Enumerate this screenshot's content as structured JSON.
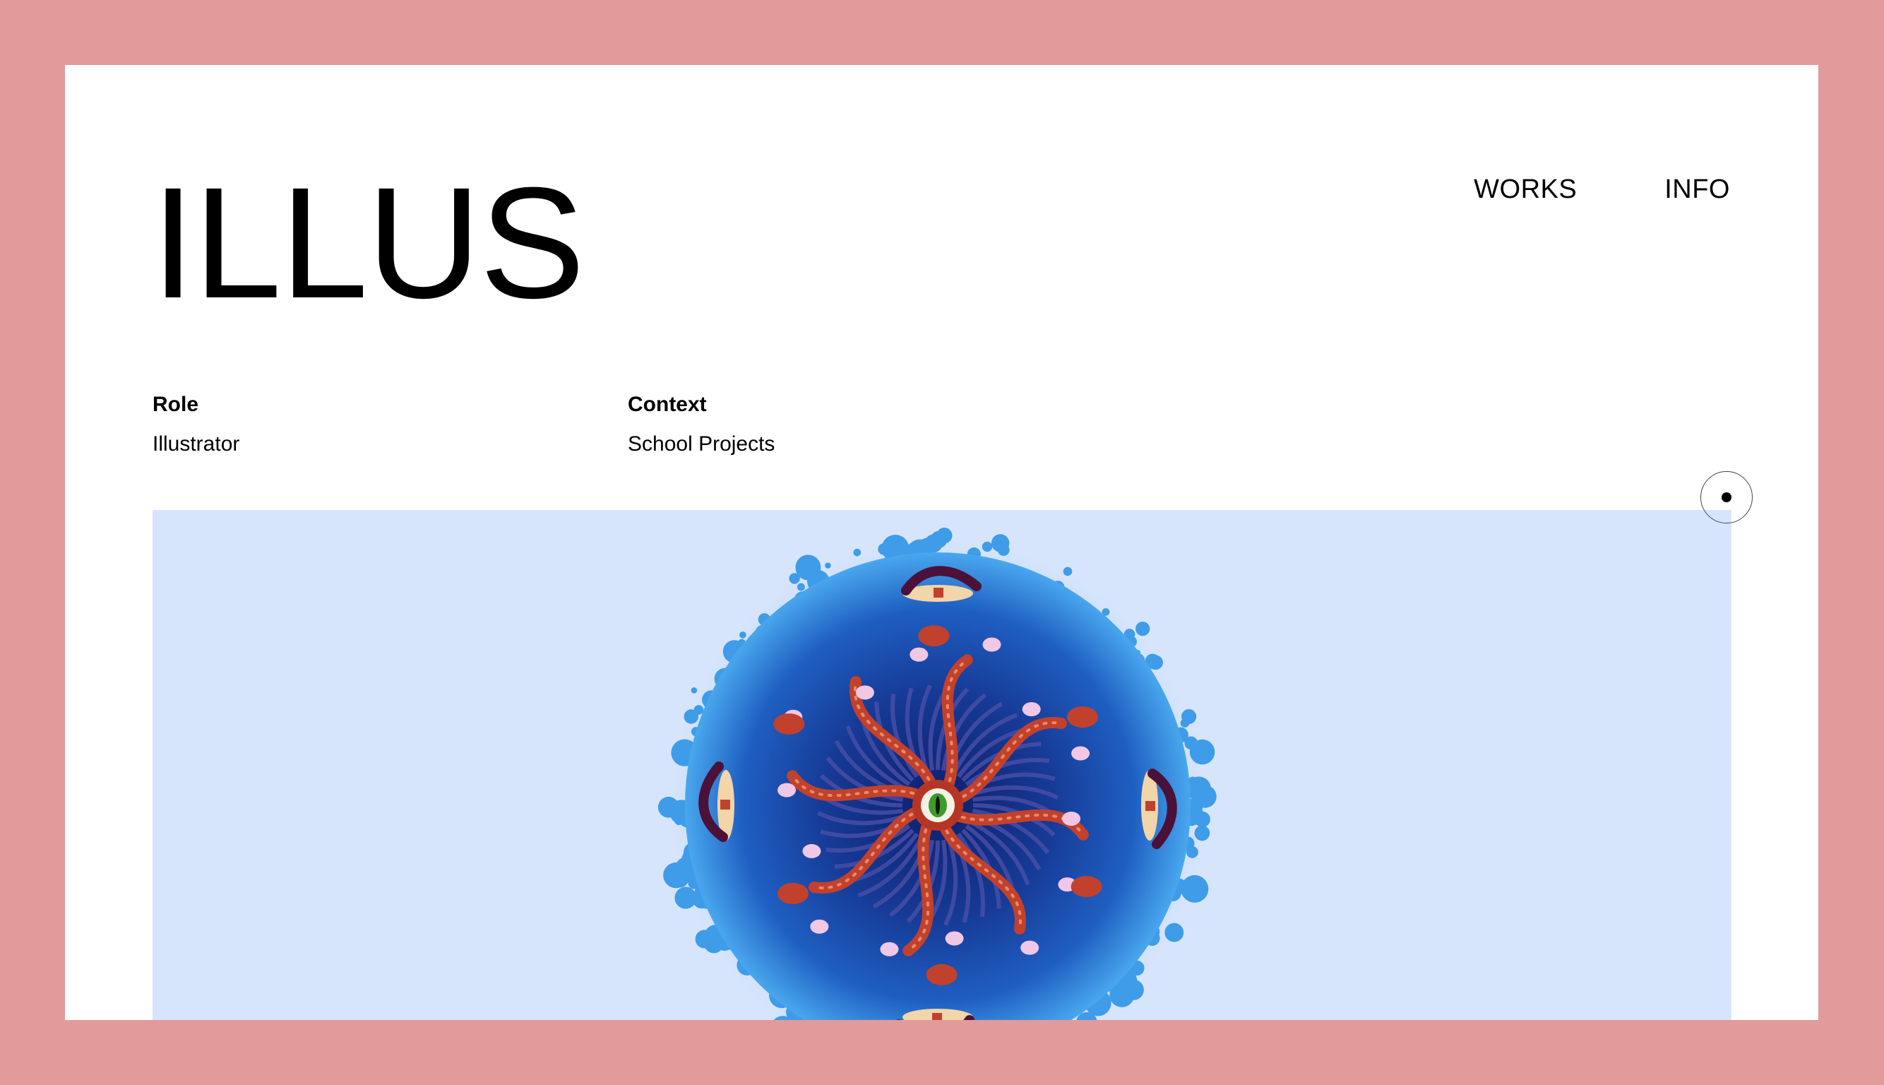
{
  "header": {
    "title": "ILLUS"
  },
  "nav": {
    "items": [
      {
        "label": "WORKS"
      },
      {
        "label": "INFO"
      }
    ]
  },
  "meta": {
    "role": {
      "label": "Role",
      "value": "Illustrator"
    },
    "context": {
      "label": "Context",
      "value": "School Projects"
    }
  },
  "artwork": {
    "background_color": "#d7e5fc",
    "ocean_colors": [
      "#49a7ee",
      "#1f5fc2",
      "#0d1e6b"
    ],
    "tentacle_color": "#c2412c",
    "eye_color": "#3f9a2c"
  },
  "theme": {
    "page_background": "#e29a9a",
    "frame_background": "#ffffff"
  }
}
